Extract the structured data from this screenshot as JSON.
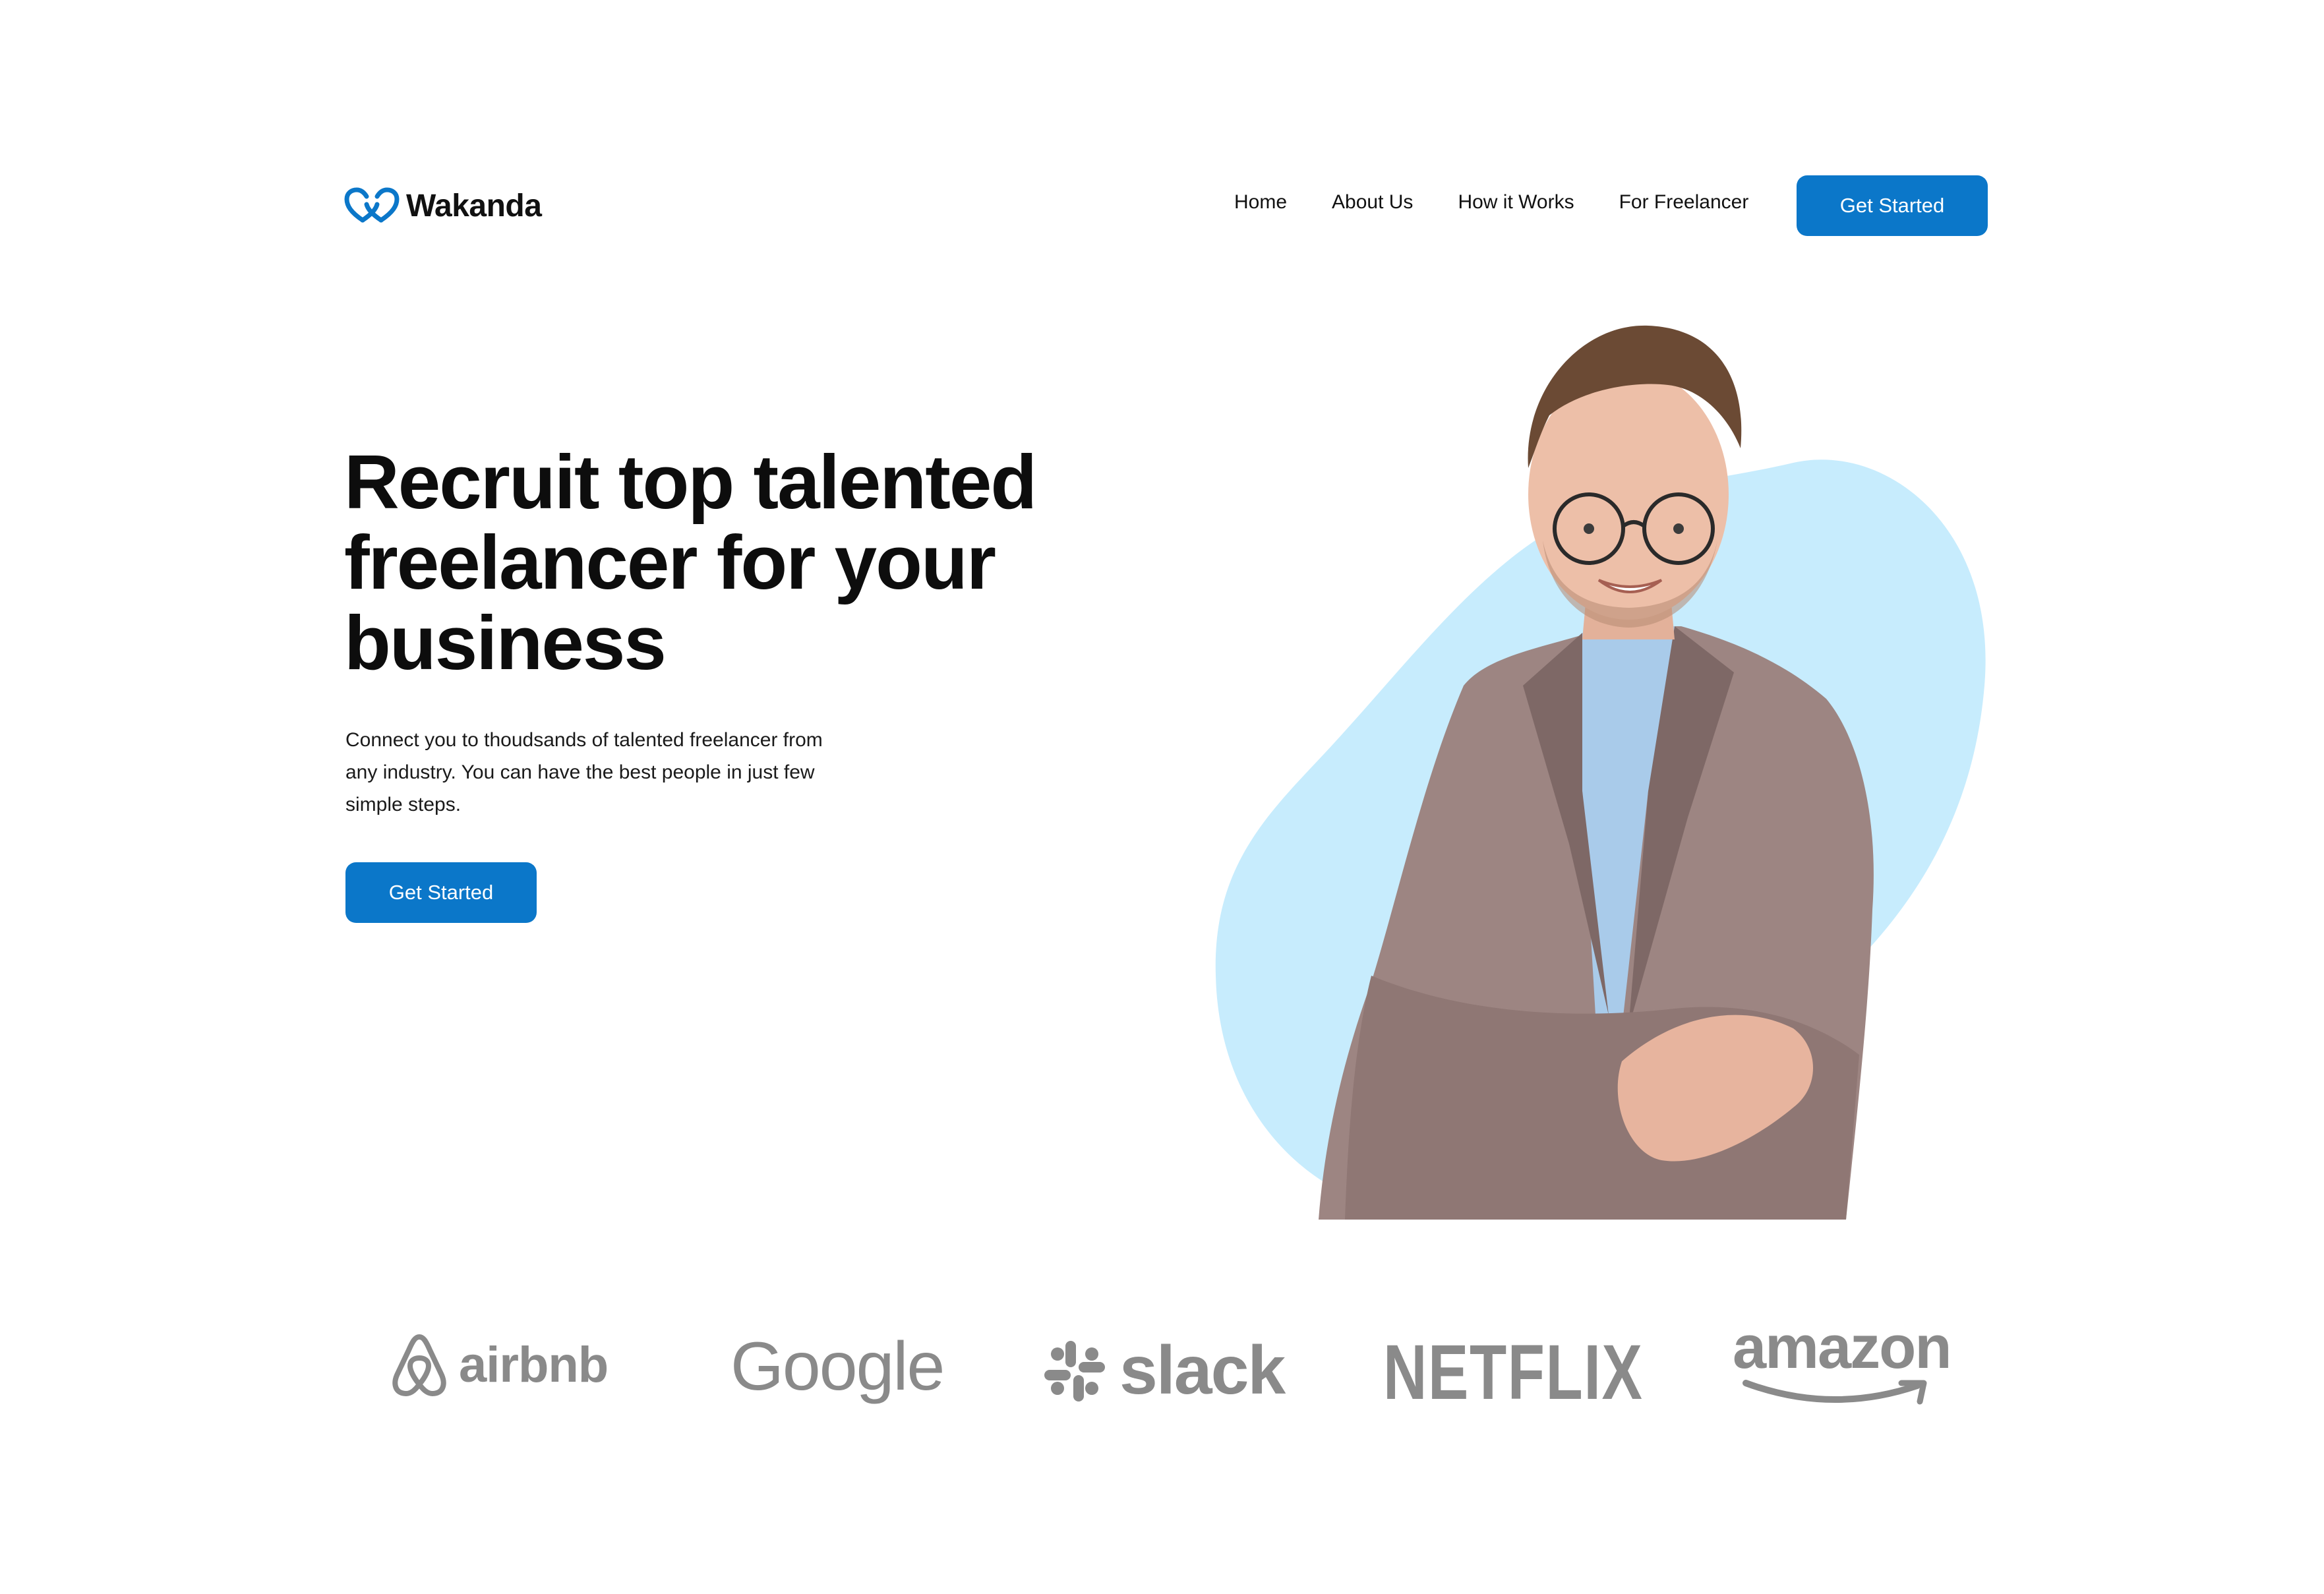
{
  "header": {
    "logo_text": "Wakanda",
    "nav": [
      "Home",
      "About Us",
      "How it Works",
      "For Freelancer"
    ],
    "cta_label": "Get Started"
  },
  "hero": {
    "title_lines": [
      "Recruit top talented",
      "freelancer for your",
      "business"
    ],
    "description_lines": [
      "Connect you to thoudsands of talented freelancer from",
      "any industry. You can have the best people in just few",
      "simple steps."
    ],
    "cta_label": "Get Started",
    "image_icon": "freelancer-portrait-illustration"
  },
  "brands": [
    "airbnb",
    "Google",
    "slack",
    "NETFLIX",
    "amazon"
  ],
  "colors": {
    "accent": "#0b77c9",
    "blob": "#c7ecfd",
    "brand_gray": "#8a8a8a",
    "text": "#111111"
  }
}
